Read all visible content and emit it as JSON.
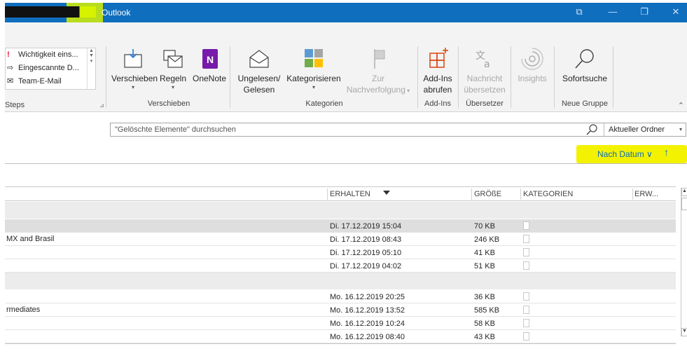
{
  "titlebar": {
    "title": "Outlook",
    "controls": [
      "⧉",
      "—",
      "❐",
      "✕"
    ]
  },
  "ribbon": {
    "quicksteps": {
      "items": [
        "Wichtigkeit eins...",
        "Eingescannte D...",
        "Team-E-Mail"
      ],
      "group_label": "Steps"
    },
    "move_group": {
      "label": "Verschieben",
      "buttons": [
        "Verschieben",
        "Regeln",
        "OneNote"
      ]
    },
    "tags_group": {
      "label": "Kategorien",
      "unread_line1": "Ungelesen/",
      "unread_line2": "Gelesen",
      "categorize": "Kategorisieren",
      "followup_line1": "Zur",
      "followup_line2": "Nachverfolgung"
    },
    "addins_group": {
      "label": "Add-Ins",
      "btn_line1": "Add-Ins",
      "btn_line2": "abrufen"
    },
    "translator_group": {
      "label": "Übersetzer",
      "btn_line1": "Nachricht",
      "btn_line2": "übersetzen"
    },
    "insights": "Insights",
    "new_group": {
      "label": "Neue Gruppe",
      "search_btn": "Sofortsuche"
    }
  },
  "search": {
    "placeholder": "\"Gelöschte Elemente\" durchsuchen",
    "scope": "Aktueller Ordner"
  },
  "sort": {
    "label": "Nach Datum ∨",
    "direction": "↑",
    "highlight_color": "#f3f200"
  },
  "list": {
    "columns": {
      "received": "ERHALTEN",
      "size": "GRÖßE",
      "categories": "KATEGORIEN",
      "more": "ERW..."
    },
    "rows_group1": [
      {
        "subject": "",
        "date": "Di. 17.12.2019 15:04",
        "size": "70 KB",
        "selected": true
      },
      {
        "subject": "MX  and  Brasil",
        "date": "Di. 17.12.2019 08:43",
        "size": "246 KB"
      },
      {
        "subject": "",
        "date": "Di. 17.12.2019 05:10",
        "size": "41 KB"
      },
      {
        "subject": "",
        "date": "Di. 17.12.2019 04:02",
        "size": "51 KB"
      }
    ],
    "rows_group2": [
      {
        "subject": "",
        "date": "Mo. 16.12.2019 20:25",
        "size": "36 KB"
      },
      {
        "subject": "rmediates",
        "date": "Mo. 16.12.2019 13:52",
        "size": "585 KB"
      },
      {
        "subject": "",
        "date": "Mo. 16.12.2019 10:24",
        "size": "58 KB"
      },
      {
        "subject": "",
        "date": "Mo. 16.12.2019 08:40",
        "size": "43 KB"
      }
    ]
  },
  "colors": {
    "titlebar": "#106ebe",
    "accent": "#0f6cbd",
    "onenote": "#7719aa",
    "addins": "#d83b01"
  }
}
